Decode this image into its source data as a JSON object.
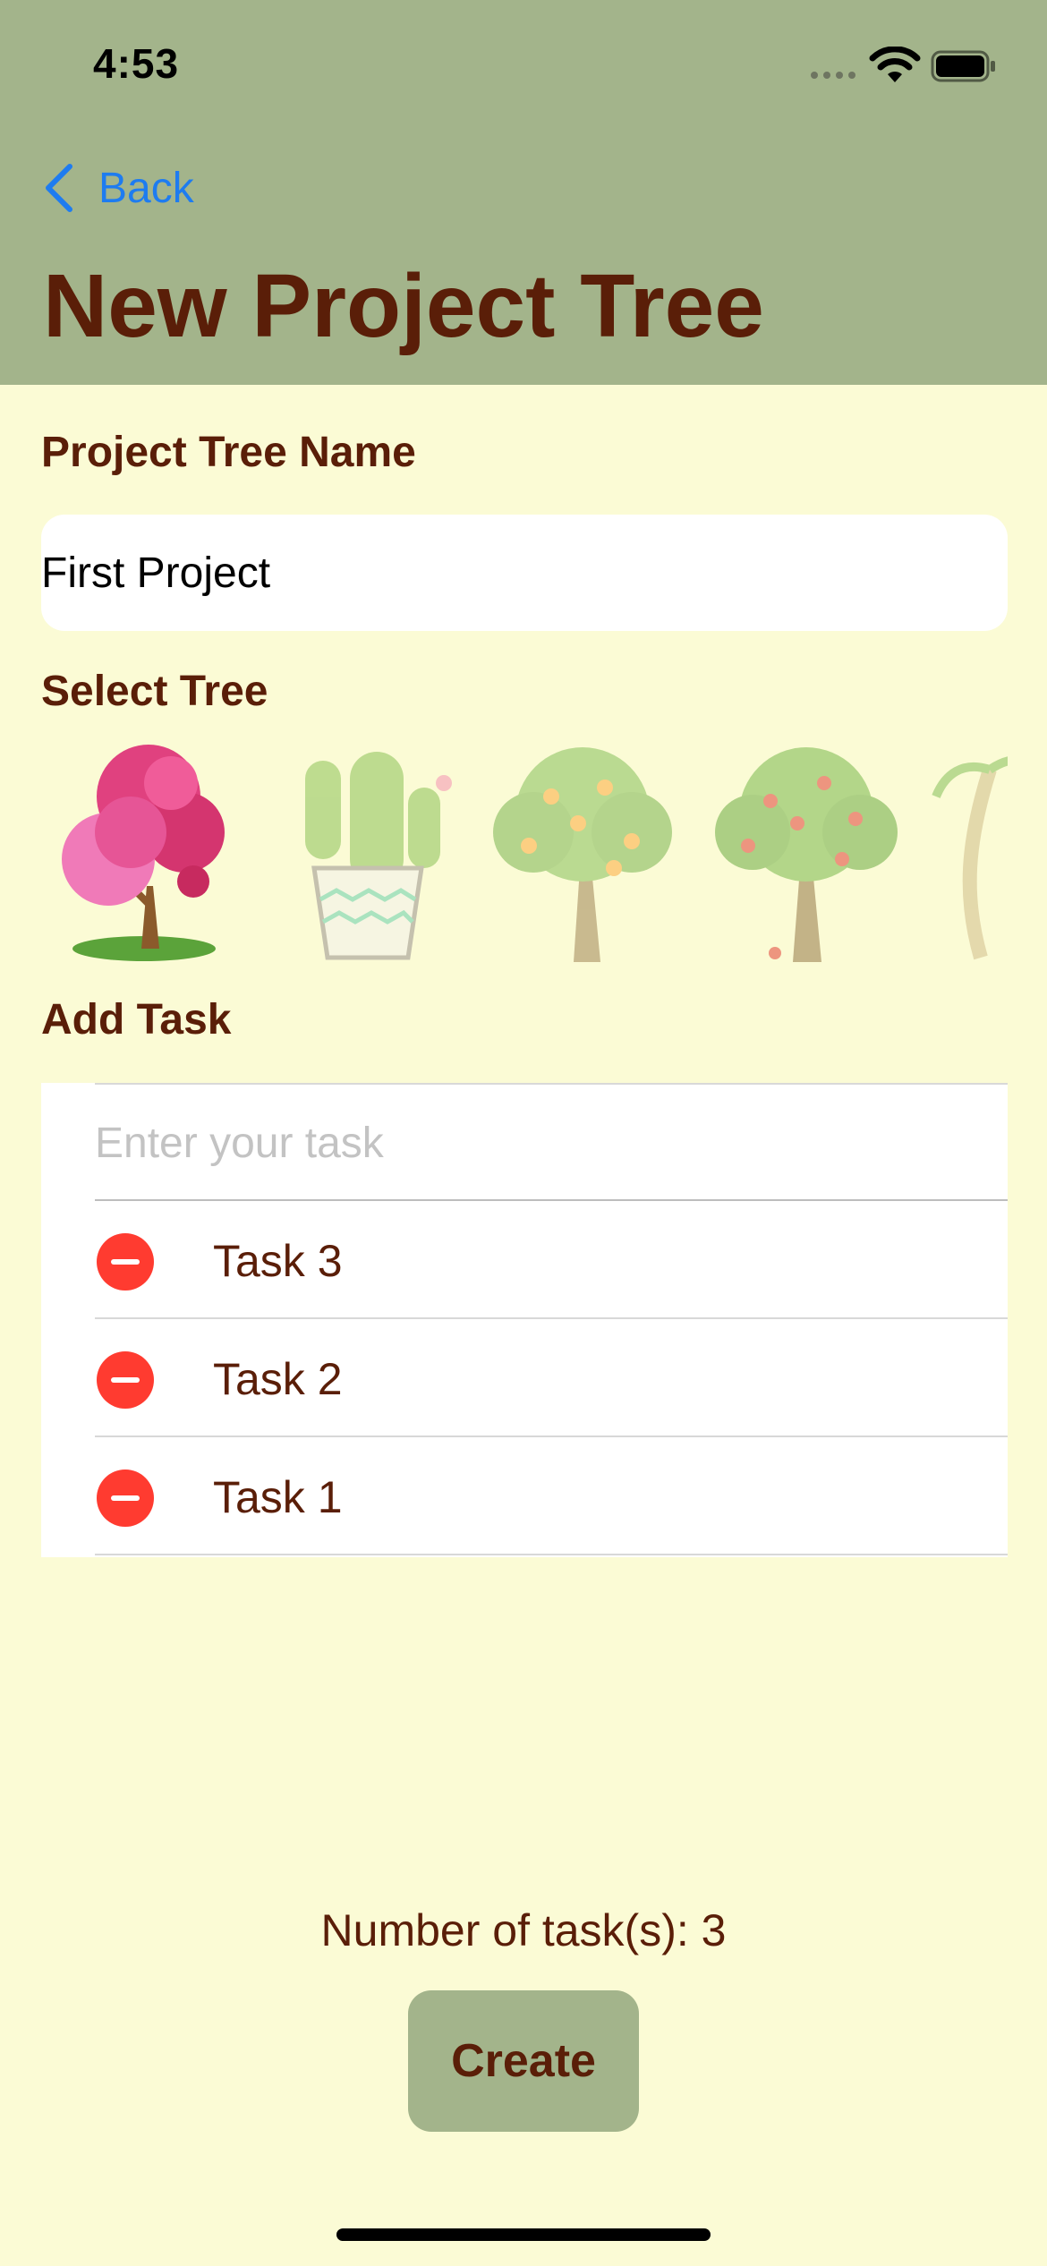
{
  "colors": {
    "header_bg": "#A3B48B",
    "page_bg": "#FBFBD5",
    "title_text": "#5A1E08",
    "link": "#1E7CF0",
    "delete": "#FF3B30"
  },
  "status_bar": {
    "time": "4:53",
    "icons": [
      "signal-dots-icon",
      "wifi-icon",
      "battery-icon"
    ]
  },
  "nav": {
    "back_label": "Back",
    "title": "New Project Tree"
  },
  "form": {
    "name_label": "Project Tree Name",
    "name_value": "First Project",
    "tree_label": "Select Tree",
    "trees": [
      {
        "name": "pink-blossom-tree",
        "selected": true
      },
      {
        "name": "cactus",
        "selected": false
      },
      {
        "name": "orange-tree",
        "selected": false
      },
      {
        "name": "apple-tree",
        "selected": false
      },
      {
        "name": "palm-tree",
        "selected": false
      }
    ],
    "task_label": "Add Task",
    "task_placeholder": "Enter your task",
    "tasks": [
      "Task 3",
      "Task 2",
      "Task 1"
    ]
  },
  "footer": {
    "count_text": "Number of task(s): 3",
    "create_label": "Create"
  }
}
